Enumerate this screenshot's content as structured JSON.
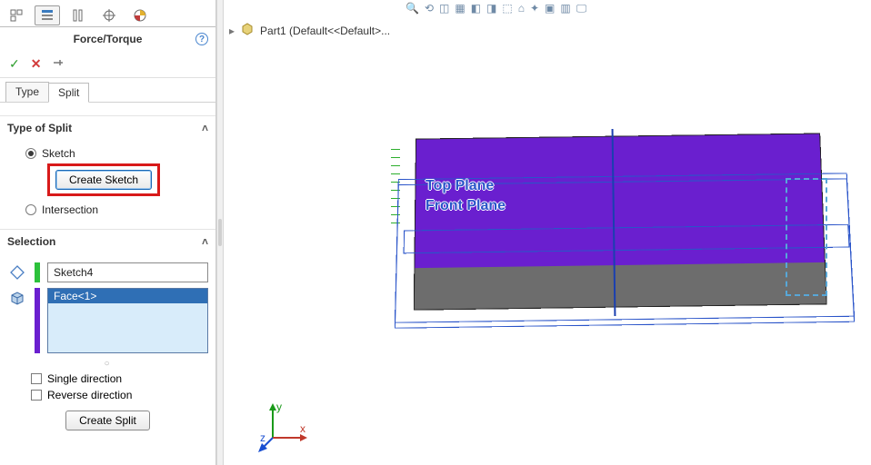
{
  "header": {
    "title": "Force/Torque"
  },
  "subtabs": {
    "type": "Type",
    "split": "Split"
  },
  "breadcrumb": {
    "part": "Part1 (Default<<Default>..."
  },
  "sections": {
    "type_of_split": {
      "title": "Type of Split",
      "sketch_label": "Sketch",
      "intersection_label": "Intersection",
      "create_sketch_btn": "Create Sketch"
    },
    "selection": {
      "title": "Selection",
      "sketch_value": "Sketch4",
      "face_item": "Face<1>",
      "single_dir": "Single direction",
      "reverse_dir": "Reverse direction",
      "create_split_btn": "Create Split"
    }
  },
  "planes": {
    "top": "Top Plane",
    "front": "Front Plane"
  },
  "triad": {
    "x": "x",
    "y": "y",
    "z": "z"
  },
  "icons": {
    "feature_tree": "feature-tree-icon",
    "property_mgr": "property-manager-icon",
    "config_mgr": "configuration-manager-icon",
    "dim_mgr": "dimxpert-icon",
    "appearance": "appearance-icon",
    "help": "?",
    "ok": "✓",
    "cancel": "✕",
    "pin": "📌",
    "chevron": "˄",
    "sketch_sel": "◈",
    "face_sel": "◪",
    "tri": "▸",
    "part": "⎔"
  },
  "colors": {
    "highlight": "#d81a1a",
    "model_top": "#6a1fcf",
    "model_bottom": "#6d6d6d",
    "plane_edge": "#2a54c9",
    "selection_bg": "#d8ecfa"
  }
}
